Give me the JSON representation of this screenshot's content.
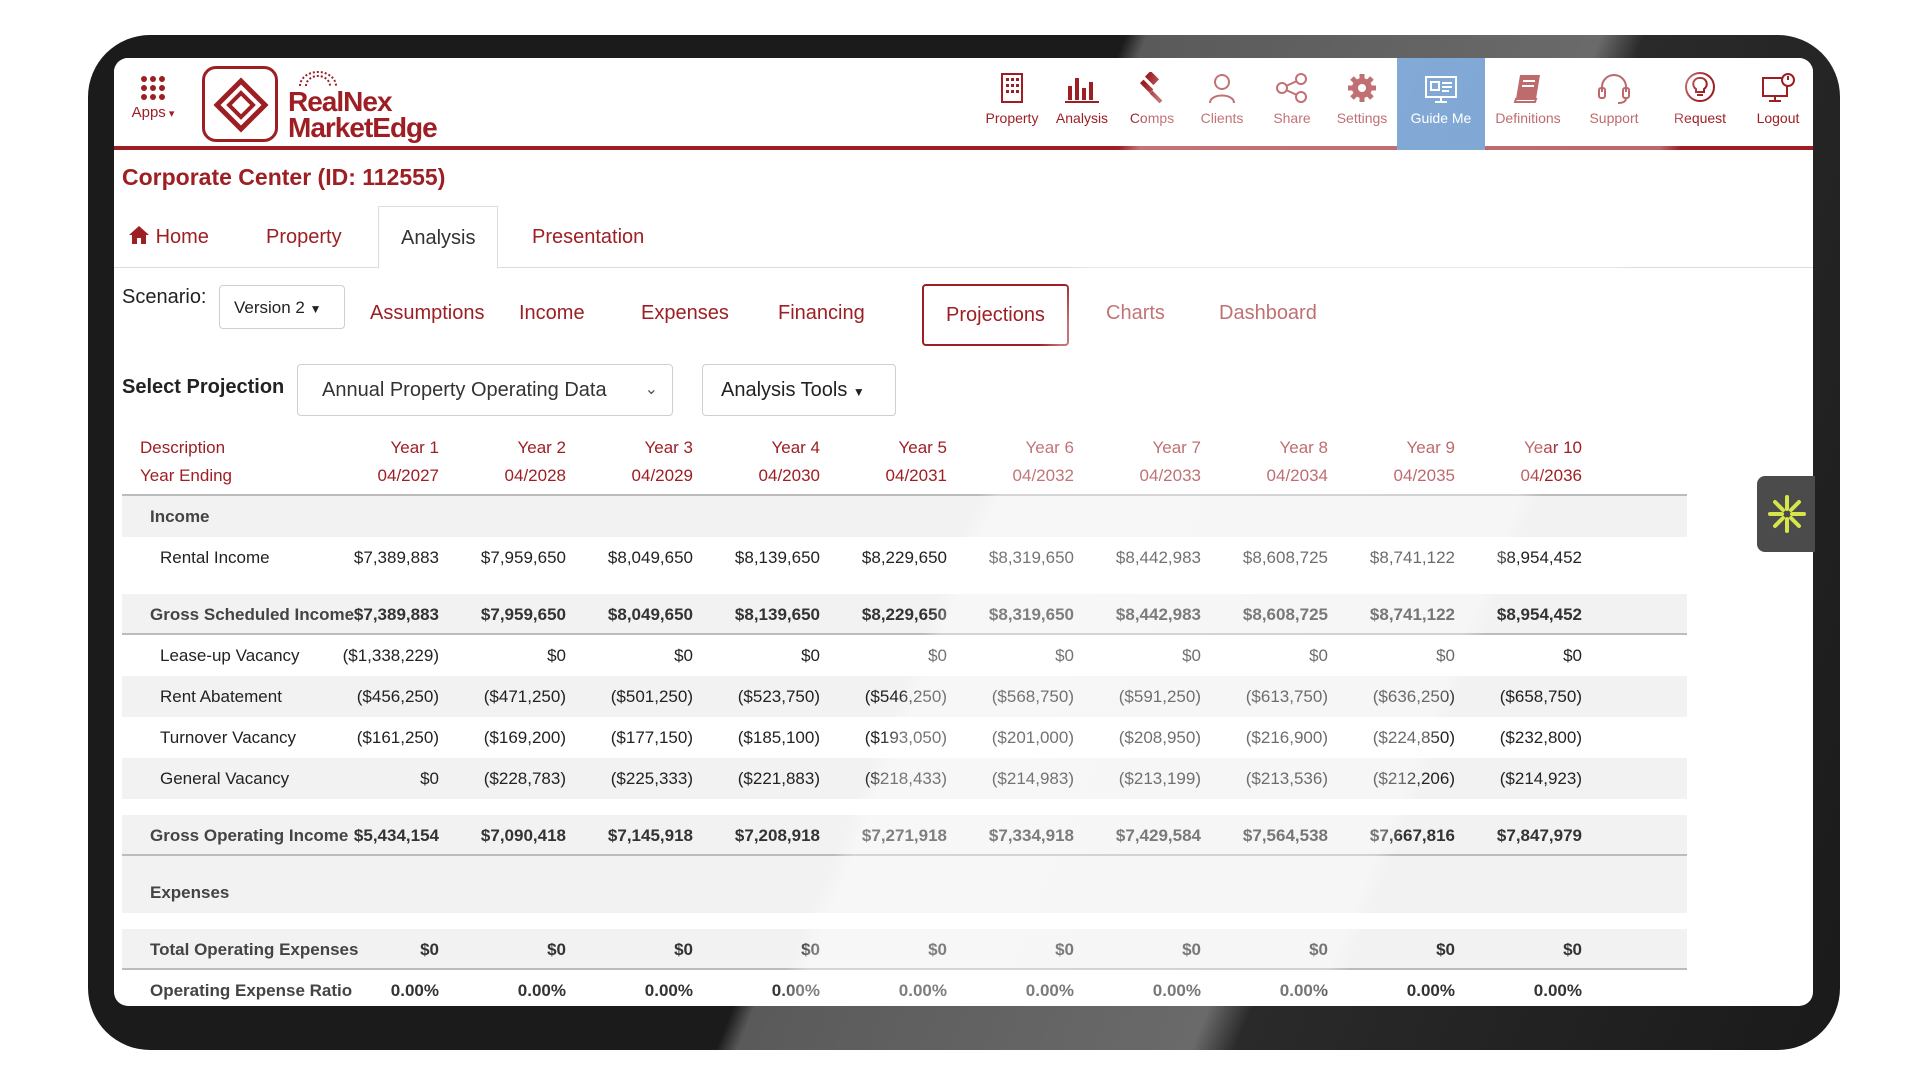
{
  "header": {
    "apps_label": "Apps",
    "logo_line1": "RealNex",
    "logo_line2": "MarketEdge",
    "nav": [
      {
        "label": "Property",
        "icon": "building-icon"
      },
      {
        "label": "Analysis",
        "icon": "bar-chart-icon"
      },
      {
        "label": "Comps",
        "icon": "gavel-icon"
      },
      {
        "label": "Clients",
        "icon": "user-icon"
      },
      {
        "label": "Share",
        "icon": "share-icon"
      },
      {
        "label": "Settings",
        "icon": "gear-icon"
      },
      {
        "label": "Guide Me",
        "icon": "guide-icon"
      },
      {
        "label": "Definitions",
        "icon": "book-icon"
      },
      {
        "label": "Support",
        "icon": "headset-icon"
      },
      {
        "label": "Request",
        "icon": "lightbulb-icon"
      },
      {
        "label": "Logout",
        "icon": "logout-icon"
      }
    ]
  },
  "title": "Corporate Center (ID: 112555)",
  "main_tabs": [
    "Home",
    "Property",
    "Analysis",
    "Presentation"
  ],
  "main_tab_active": "Analysis",
  "scenario": {
    "label": "Scenario:",
    "value": "Version 2"
  },
  "sub_tabs": [
    "Assumptions",
    "Income",
    "Expenses",
    "Financing",
    "Projections",
    "Charts",
    "Dashboard"
  ],
  "sub_tab_active": "Projections",
  "select_projection": {
    "label": "Select Projection",
    "value": "Annual Property Operating Data"
  },
  "analysis_tools": "Analysis Tools",
  "table": {
    "desc_header": "Description",
    "year_ending_header": "Year Ending",
    "years": [
      "Year 1",
      "Year 2",
      "Year 3",
      "Year 4",
      "Year 5",
      "Year 6",
      "Year 7",
      "Year 8",
      "Year 9",
      "Year 10"
    ],
    "year_endings": [
      "04/2027",
      "04/2028",
      "04/2029",
      "04/2030",
      "04/2031",
      "04/2032",
      "04/2033",
      "04/2034",
      "04/2035",
      "04/2036"
    ],
    "sections": {
      "income": "Income",
      "rental_income": {
        "label": "Rental Income",
        "values": [
          "$7,389,883",
          "$7,959,650",
          "$8,049,650",
          "$8,139,650",
          "$8,229,650",
          "$8,319,650",
          "$8,442,983",
          "$8,608,725",
          "$8,741,122",
          "$8,954,452"
        ]
      },
      "gsi": {
        "label": "Gross Scheduled Income",
        "values": [
          "$7,389,883",
          "$7,959,650",
          "$8,049,650",
          "$8,139,650",
          "$8,229,650",
          "$8,319,650",
          "$8,442,983",
          "$8,608,725",
          "$8,741,122",
          "$8,954,452"
        ]
      },
      "leaseup": {
        "label": "Lease-up Vacancy",
        "values": [
          "($1,338,229)",
          "$0",
          "$0",
          "$0",
          "$0",
          "$0",
          "$0",
          "$0",
          "$0",
          "$0"
        ]
      },
      "abatement": {
        "label": "Rent Abatement",
        "values": [
          "($456,250)",
          "($471,250)",
          "($501,250)",
          "($523,750)",
          "($546,250)",
          "($568,750)",
          "($591,250)",
          "($613,750)",
          "($636,250)",
          "($658,750)"
        ]
      },
      "turnover": {
        "label": "Turnover Vacancy",
        "values": [
          "($161,250)",
          "($169,200)",
          "($177,150)",
          "($185,100)",
          "($193,050)",
          "($201,000)",
          "($208,950)",
          "($216,900)",
          "($224,850)",
          "($232,800)"
        ]
      },
      "general": {
        "label": "General Vacancy",
        "values": [
          "$0",
          "($228,783)",
          "($225,333)",
          "($221,883)",
          "($218,433)",
          "($214,983)",
          "($213,199)",
          "($213,536)",
          "($212,206)",
          "($214,923)"
        ]
      },
      "goi": {
        "label": "Gross Operating Income",
        "values": [
          "$5,434,154",
          "$7,090,418",
          "$7,145,918",
          "$7,208,918",
          "$7,271,918",
          "$7,334,918",
          "$7,429,584",
          "$7,564,538",
          "$7,667,816",
          "$7,847,979"
        ]
      },
      "expenses": "Expenses",
      "toe": {
        "label": "Total Operating Expenses",
        "values": [
          "$0",
          "$0",
          "$0",
          "$0",
          "$0",
          "$0",
          "$0",
          "$0",
          "$0",
          "$0"
        ]
      },
      "oer": {
        "label": "Operating Expense Ratio",
        "values": [
          "0.00%",
          "0.00%",
          "0.00%",
          "0.00%",
          "0.00%",
          "0.00%",
          "0.00%",
          "0.00%",
          "0.00%",
          "0.00%"
        ]
      }
    }
  },
  "colors": {
    "brand": "#9d1f24",
    "active_nav": "#3f7bbf",
    "widget": "#4b4b4b",
    "widget_accent": "#d6e64a"
  }
}
